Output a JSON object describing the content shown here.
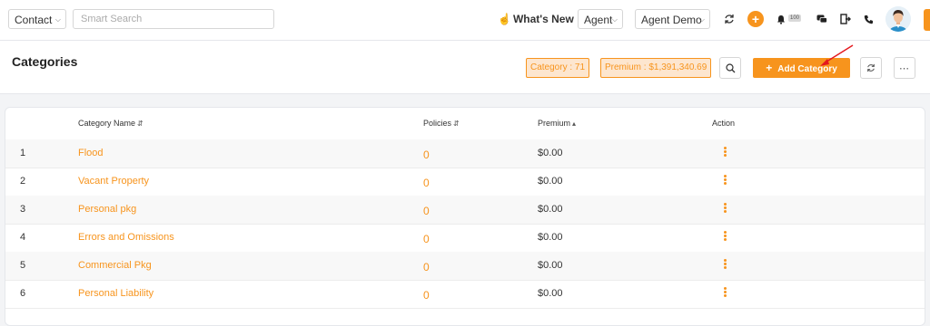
{
  "topbar": {
    "entity_select": "Contact",
    "search_placeholder": "Smart Search",
    "whats_new": "What's New",
    "role_select": "Agent",
    "user_select": "Agent Demo",
    "notification_count": "100"
  },
  "header": {
    "title": "Categories",
    "category_badge": "Category : 71",
    "premium_badge": "Premium : $1,391,340.69",
    "add_button": "Add Category",
    "add_button_icon": "+"
  },
  "table": {
    "columns": {
      "name": "Category Name",
      "policies": "Policies",
      "premium": "Premium",
      "action": "Action"
    },
    "rows": [
      {
        "index": "1",
        "name": "Flood",
        "policies": "0",
        "premium": "$0.00"
      },
      {
        "index": "2",
        "name": "Vacant Property",
        "policies": "0",
        "premium": "$0.00"
      },
      {
        "index": "3",
        "name": "Personal pkg",
        "policies": "0",
        "premium": "$0.00"
      },
      {
        "index": "4",
        "name": "Errors and Omissions",
        "policies": "0",
        "premium": "$0.00"
      },
      {
        "index": "5",
        "name": "Commercial Pkg",
        "policies": "0",
        "premium": "$0.00"
      },
      {
        "index": "6",
        "name": "Personal Liability",
        "policies": "0",
        "premium": "$0.00"
      }
    ]
  },
  "colors": {
    "accent": "#f7941d",
    "badge_bg": "#fde6cf"
  }
}
